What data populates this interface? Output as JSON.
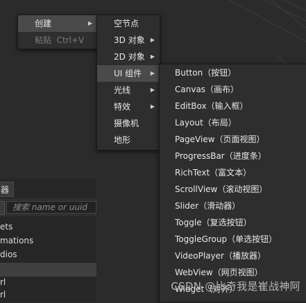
{
  "menu1": {
    "items": [
      {
        "label": "创建",
        "has_submenu": true
      },
      {
        "label": "粘贴  Ctrl+V",
        "disabled": true
      }
    ]
  },
  "menu2": {
    "items": [
      {
        "label": "空节点"
      },
      {
        "label": "3D 对象",
        "has_submenu": true
      },
      {
        "label": "2D 对象",
        "has_submenu": true
      },
      {
        "label": "UI 组件",
        "has_submenu": true
      },
      {
        "label": "光线",
        "has_submenu": true
      },
      {
        "label": "特效",
        "has_submenu": true
      },
      {
        "label": "摄像机"
      },
      {
        "label": "地形"
      }
    ]
  },
  "menu3": {
    "items": [
      {
        "label": "Button（按钮）"
      },
      {
        "label": "Canvas（画布）"
      },
      {
        "label": "EditBox（输入框）"
      },
      {
        "label": "Layout（布局）"
      },
      {
        "label": "PageView（页面视图）"
      },
      {
        "label": "ProgressBar（进度条）"
      },
      {
        "label": "RichText（富文本）"
      },
      {
        "label": "ScrollView（滚动视图）"
      },
      {
        "label": "Slider（滑动器）"
      },
      {
        "label": "Toggle（复选按钮）"
      },
      {
        "label": "ToggleGroup（单选按钮）"
      },
      {
        "label": "VideoPlayer（播放器）"
      },
      {
        "label": "WebView（网页视图）"
      },
      {
        "label": "Widget（对齐）"
      }
    ]
  },
  "panel": {
    "tab_label": "器",
    "search_placeholder": "搜索 name or uuid",
    "assets": [
      "ets",
      "mations",
      "dios",
      "",
      "rl",
      "rl"
    ]
  },
  "watermark": "CSDN @比奇我是崔战神阿",
  "colors": {
    "menu_bg": "#2e2e2e",
    "highlight": "#4a4a4a",
    "disabled_text": "#7d7d7d"
  }
}
